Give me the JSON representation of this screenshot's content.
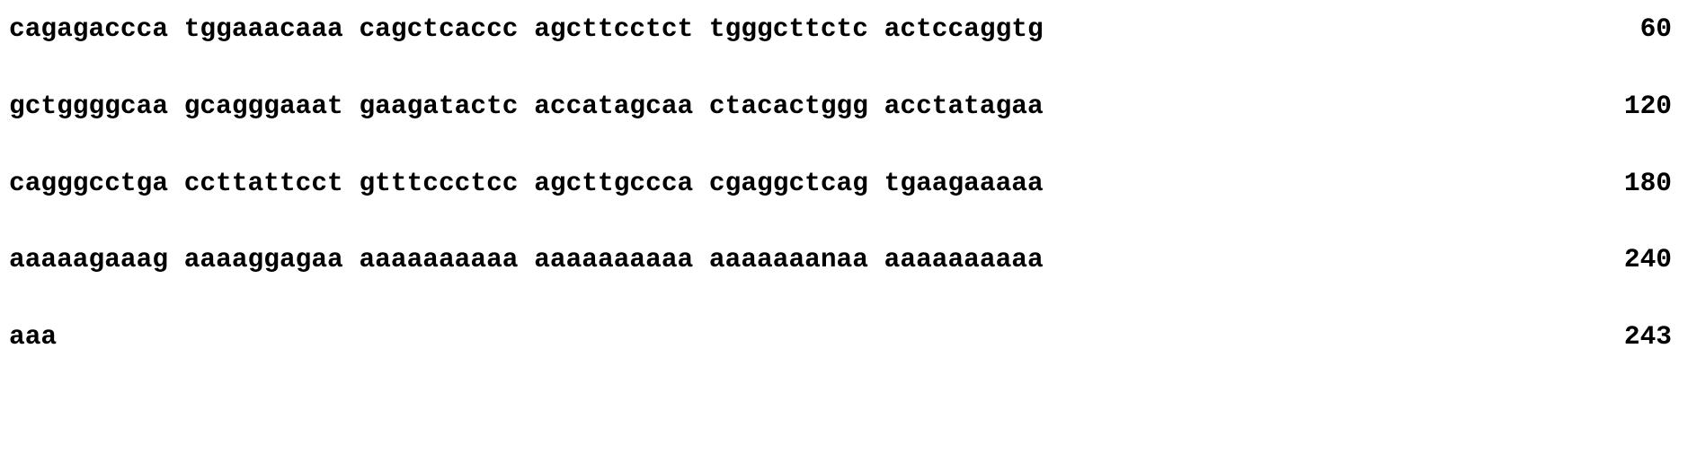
{
  "sequence": {
    "lines": [
      {
        "text": "cagagaccca tggaaacaaa cagctcaccc agcttcctct tgggcttctc actccaggtg",
        "position": "60"
      },
      {
        "text": "gctggggcaa gcagggaaat gaagatactc accatagcaa ctacactggg acctatagaa",
        "position": "120"
      },
      {
        "text": "cagggcctga ccttattcct gtttccctcc agcttgccca cgaggctcag tgaagaaaaa",
        "position": "180"
      },
      {
        "text": "aaaaagaaag aaaaggagaa aaaaaaaaaa aaaaaaaaaa aaaaaaanaa aaaaaaaaaa",
        "position": "240"
      },
      {
        "text": "aaa",
        "position": "243"
      }
    ]
  }
}
